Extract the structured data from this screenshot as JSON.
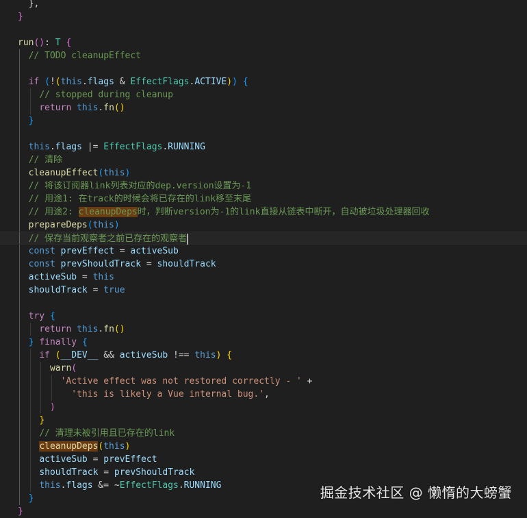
{
  "editor": {
    "language": "typescript",
    "theme": "dark",
    "lines": [
      {
        "tokens": [
          [
            "pun",
            "  },"
          ]
        ]
      },
      {
        "tokens": [
          [
            "br2",
            "}"
          ]
        ]
      },
      {
        "tokens": []
      },
      {
        "tokens": [
          [
            "fn",
            "run"
          ],
          [
            "br2",
            "()"
          ],
          [
            "pun",
            ": "
          ],
          [
            "type",
            "T"
          ],
          [
            "pun",
            " "
          ],
          [
            "br2",
            "{"
          ]
        ]
      },
      {
        "tokens": [
          [
            "pun",
            "  "
          ],
          [
            "cmt",
            "// TODO cleanupEffect"
          ]
        ]
      },
      {
        "tokens": []
      },
      {
        "tokens": [
          [
            "pun",
            "  "
          ],
          [
            "ctl",
            "if"
          ],
          [
            "pun",
            " "
          ],
          [
            "br3",
            "("
          ],
          [
            "pun",
            "!"
          ],
          [
            "br1",
            "("
          ],
          [
            "kw",
            "this"
          ],
          [
            "pun",
            "."
          ],
          [
            "var",
            "flags"
          ],
          [
            "pun",
            " & "
          ],
          [
            "type",
            "EffectFlags"
          ],
          [
            "pun",
            "."
          ],
          [
            "var",
            "ACTIVE"
          ],
          [
            "br1",
            ")"
          ],
          [
            "br3",
            ")"
          ],
          [
            "pun",
            " "
          ],
          [
            "br3",
            "{"
          ]
        ]
      },
      {
        "tokens": [
          [
            "pun",
            "    "
          ],
          [
            "cmt",
            "// stopped during cleanup"
          ]
        ]
      },
      {
        "tokens": [
          [
            "pun",
            "    "
          ],
          [
            "ctl",
            "return"
          ],
          [
            "pun",
            " "
          ],
          [
            "kw",
            "this"
          ],
          [
            "pun",
            "."
          ],
          [
            "fn",
            "fn"
          ],
          [
            "br1",
            "()"
          ]
        ]
      },
      {
        "tokens": [
          [
            "pun",
            "  "
          ],
          [
            "br3",
            "}"
          ]
        ]
      },
      {
        "tokens": []
      },
      {
        "tokens": [
          [
            "pun",
            "  "
          ],
          [
            "kw",
            "this"
          ],
          [
            "pun",
            "."
          ],
          [
            "var",
            "flags"
          ],
          [
            "pun",
            " |= "
          ],
          [
            "type",
            "EffectFlags"
          ],
          [
            "pun",
            "."
          ],
          [
            "var",
            "RUNNING"
          ]
        ]
      },
      {
        "tokens": [
          [
            "pun",
            "  "
          ],
          [
            "cmt",
            "// 清除"
          ]
        ]
      },
      {
        "tokens": [
          [
            "pun",
            "  "
          ],
          [
            "fn",
            "cleanupEffect"
          ],
          [
            "br3",
            "("
          ],
          [
            "kw",
            "this"
          ],
          [
            "br3",
            ")"
          ]
        ]
      },
      {
        "tokens": [
          [
            "pun",
            "  "
          ],
          [
            "cmt",
            "// 将该订阅器link列表对应的dep.version设置为-1"
          ]
        ]
      },
      {
        "tokens": [
          [
            "pun",
            "  "
          ],
          [
            "cmt",
            "// 用途1: 在track的时候会将已存在的link移至末尾"
          ]
        ]
      },
      {
        "tokens": [
          [
            "pun",
            "  "
          ],
          [
            "cmt",
            "// 用途2: "
          ],
          [
            "cmthl",
            "cleanupDeps"
          ],
          [
            "cmt",
            "时，判断version为-1的link直接从链表中断开，自动被垃圾处理器回收"
          ]
        ]
      },
      {
        "tokens": [
          [
            "pun",
            "  "
          ],
          [
            "fn",
            "prepareDeps"
          ],
          [
            "br3",
            "("
          ],
          [
            "kw",
            "this"
          ],
          [
            "br3",
            ")"
          ]
        ]
      },
      {
        "tokens": [
          [
            "pun",
            "  "
          ],
          [
            "cmt",
            "// 保存当前观察者之前已存在的观察者"
          ],
          [
            "cursor",
            ""
          ]
        ],
        "current": true
      },
      {
        "tokens": [
          [
            "pun",
            "  "
          ],
          [
            "kw",
            "const"
          ],
          [
            "pun",
            " "
          ],
          [
            "var",
            "prevEffect"
          ],
          [
            "pun",
            " = "
          ],
          [
            "var",
            "activeSub"
          ]
        ]
      },
      {
        "tokens": [
          [
            "pun",
            "  "
          ],
          [
            "kw",
            "const"
          ],
          [
            "pun",
            " "
          ],
          [
            "var",
            "prevShouldTrack"
          ],
          [
            "pun",
            " = "
          ],
          [
            "var",
            "shouldTrack"
          ]
        ]
      },
      {
        "tokens": [
          [
            "pun",
            "  "
          ],
          [
            "var",
            "activeSub"
          ],
          [
            "pun",
            " = "
          ],
          [
            "kw",
            "this"
          ]
        ]
      },
      {
        "tokens": [
          [
            "pun",
            "  "
          ],
          [
            "var",
            "shouldTrack"
          ],
          [
            "pun",
            " = "
          ],
          [
            "kw",
            "true"
          ]
        ]
      },
      {
        "tokens": []
      },
      {
        "tokens": [
          [
            "pun",
            "  "
          ],
          [
            "ctl",
            "try"
          ],
          [
            "pun",
            " "
          ],
          [
            "br3",
            "{"
          ]
        ]
      },
      {
        "tokens": [
          [
            "pun",
            "    "
          ],
          [
            "ctl",
            "return"
          ],
          [
            "pun",
            " "
          ],
          [
            "kw",
            "this"
          ],
          [
            "pun",
            "."
          ],
          [
            "fn",
            "fn"
          ],
          [
            "br1",
            "()"
          ]
        ]
      },
      {
        "tokens": [
          [
            "pun",
            "  "
          ],
          [
            "br3",
            "}"
          ],
          [
            "pun",
            " "
          ],
          [
            "ctl",
            "finally"
          ],
          [
            "pun",
            " "
          ],
          [
            "br3",
            "{"
          ]
        ]
      },
      {
        "tokens": [
          [
            "pun",
            "    "
          ],
          [
            "ctl",
            "if"
          ],
          [
            "pun",
            " "
          ],
          [
            "br1",
            "("
          ],
          [
            "var",
            "__DEV__"
          ],
          [
            "pun",
            " && "
          ],
          [
            "var",
            "activeSub"
          ],
          [
            "pun",
            " !== "
          ],
          [
            "kw",
            "this"
          ],
          [
            "br1",
            ")"
          ],
          [
            "pun",
            " "
          ],
          [
            "br1",
            "{"
          ]
        ]
      },
      {
        "tokens": [
          [
            "pun",
            "      "
          ],
          [
            "fn",
            "warn"
          ],
          [
            "br2",
            "("
          ]
        ]
      },
      {
        "tokens": [
          [
            "pun",
            "        "
          ],
          [
            "str",
            "'Active effect was not restored correctly - '"
          ],
          [
            "pun",
            " +"
          ]
        ]
      },
      {
        "tokens": [
          [
            "pun",
            "          "
          ],
          [
            "str",
            "'this is likely a Vue internal bug.'"
          ],
          [
            "pun",
            ","
          ]
        ]
      },
      {
        "tokens": [
          [
            "pun",
            "      "
          ],
          [
            "br2",
            ")"
          ]
        ]
      },
      {
        "tokens": [
          [
            "pun",
            "    "
          ],
          [
            "br1",
            "}"
          ]
        ]
      },
      {
        "tokens": [
          [
            "pun",
            "    "
          ],
          [
            "cmt",
            "// 清理未被引用且已存在的link"
          ]
        ]
      },
      {
        "tokens": [
          [
            "pun",
            "    "
          ],
          [
            "fnhl",
            "cleanupDeps"
          ],
          [
            "br1",
            "("
          ],
          [
            "kw",
            "this"
          ],
          [
            "br1",
            ")"
          ]
        ]
      },
      {
        "tokens": [
          [
            "pun",
            "    "
          ],
          [
            "var",
            "activeSub"
          ],
          [
            "pun",
            " = "
          ],
          [
            "var",
            "prevEffect"
          ]
        ]
      },
      {
        "tokens": [
          [
            "pun",
            "    "
          ],
          [
            "var",
            "shouldTrack"
          ],
          [
            "pun",
            " = "
          ],
          [
            "var",
            "prevShouldTrack"
          ]
        ]
      },
      {
        "tokens": [
          [
            "pun",
            "    "
          ],
          [
            "kw",
            "this"
          ],
          [
            "pun",
            "."
          ],
          [
            "var",
            "flags"
          ],
          [
            "pun",
            " &= ~"
          ],
          [
            "type",
            "EffectFlags"
          ],
          [
            "pun",
            "."
          ],
          [
            "var",
            "RUNNING"
          ]
        ]
      },
      {
        "tokens": [
          [
            "pun",
            "  "
          ],
          [
            "br3",
            "}"
          ]
        ]
      },
      {
        "tokens": [
          [
            "br2",
            "}"
          ]
        ]
      }
    ]
  },
  "watermark": {
    "text": "掘金技术社区 @ 懒惰的大螃蟹"
  },
  "colors": {
    "background": "#1f1f1f",
    "keyword": "#569cd6",
    "control": "#c586c0",
    "function": "#dcdcaa",
    "variable": "#9cdcfe",
    "type": "#4ec9b0",
    "string": "#ce9178",
    "comment": "#6a9955",
    "highlight": "#6b3b12"
  }
}
